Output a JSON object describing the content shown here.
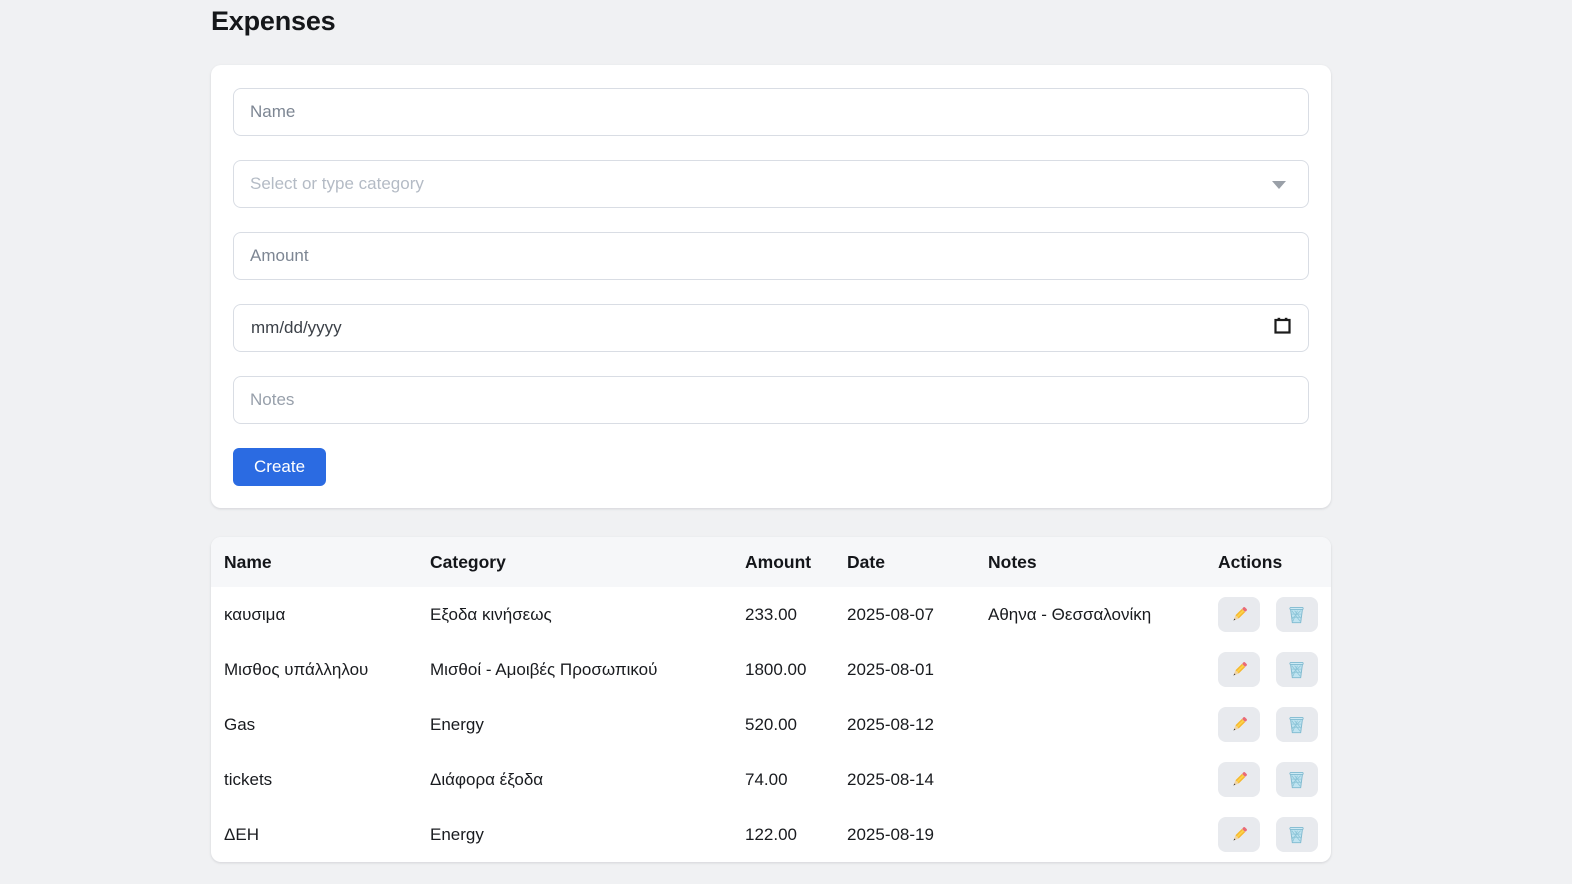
{
  "page": {
    "title": "Expenses"
  },
  "form": {
    "name_placeholder": "Name",
    "category_placeholder": "Select or type category",
    "amount_placeholder": "Amount",
    "date_placeholder": "mm/dd/yyyy",
    "notes_placeholder": "Notes",
    "create_label": "Create",
    "icons": {
      "category_caret": "chevron-down",
      "date_icon": "calendar"
    }
  },
  "table": {
    "headers": [
      "Name",
      "Category",
      "Amount",
      "Date",
      "Notes",
      "Actions"
    ],
    "rows": [
      {
        "name": "καυσιμα",
        "category": "Εξοδα κινήσεως",
        "amount": "233.00",
        "date": "2025-08-07",
        "notes": "Αθηνα - Θεσσαλονίκη"
      },
      {
        "name": "Μισθος υπάλληλου",
        "category": "Μισθοί - Αμοιβές Προσωπικού",
        "amount": "1800.00",
        "date": "2025-08-01",
        "notes": ""
      },
      {
        "name": "Gas",
        "category": "Energy",
        "amount": "520.00",
        "date": "2025-08-12",
        "notes": ""
      },
      {
        "name": "tickets",
        "category": "Διάφορα έξοδα",
        "amount": "74.00",
        "date": "2025-08-14",
        "notes": ""
      },
      {
        "name": "ΔΕΗ",
        "category": "Energy",
        "amount": "122.00",
        "date": "2025-08-19",
        "notes": ""
      }
    ],
    "action_icons": [
      "pencil",
      "wastebasket"
    ]
  },
  "colors": {
    "page_background": "#f0f1f3",
    "card_background": "#ffffff",
    "accent_blue": "#2b6be2",
    "table_header_background": "#f6f7f9",
    "input_border": "#d9dde4",
    "action_button_background": "#e8eaee"
  }
}
